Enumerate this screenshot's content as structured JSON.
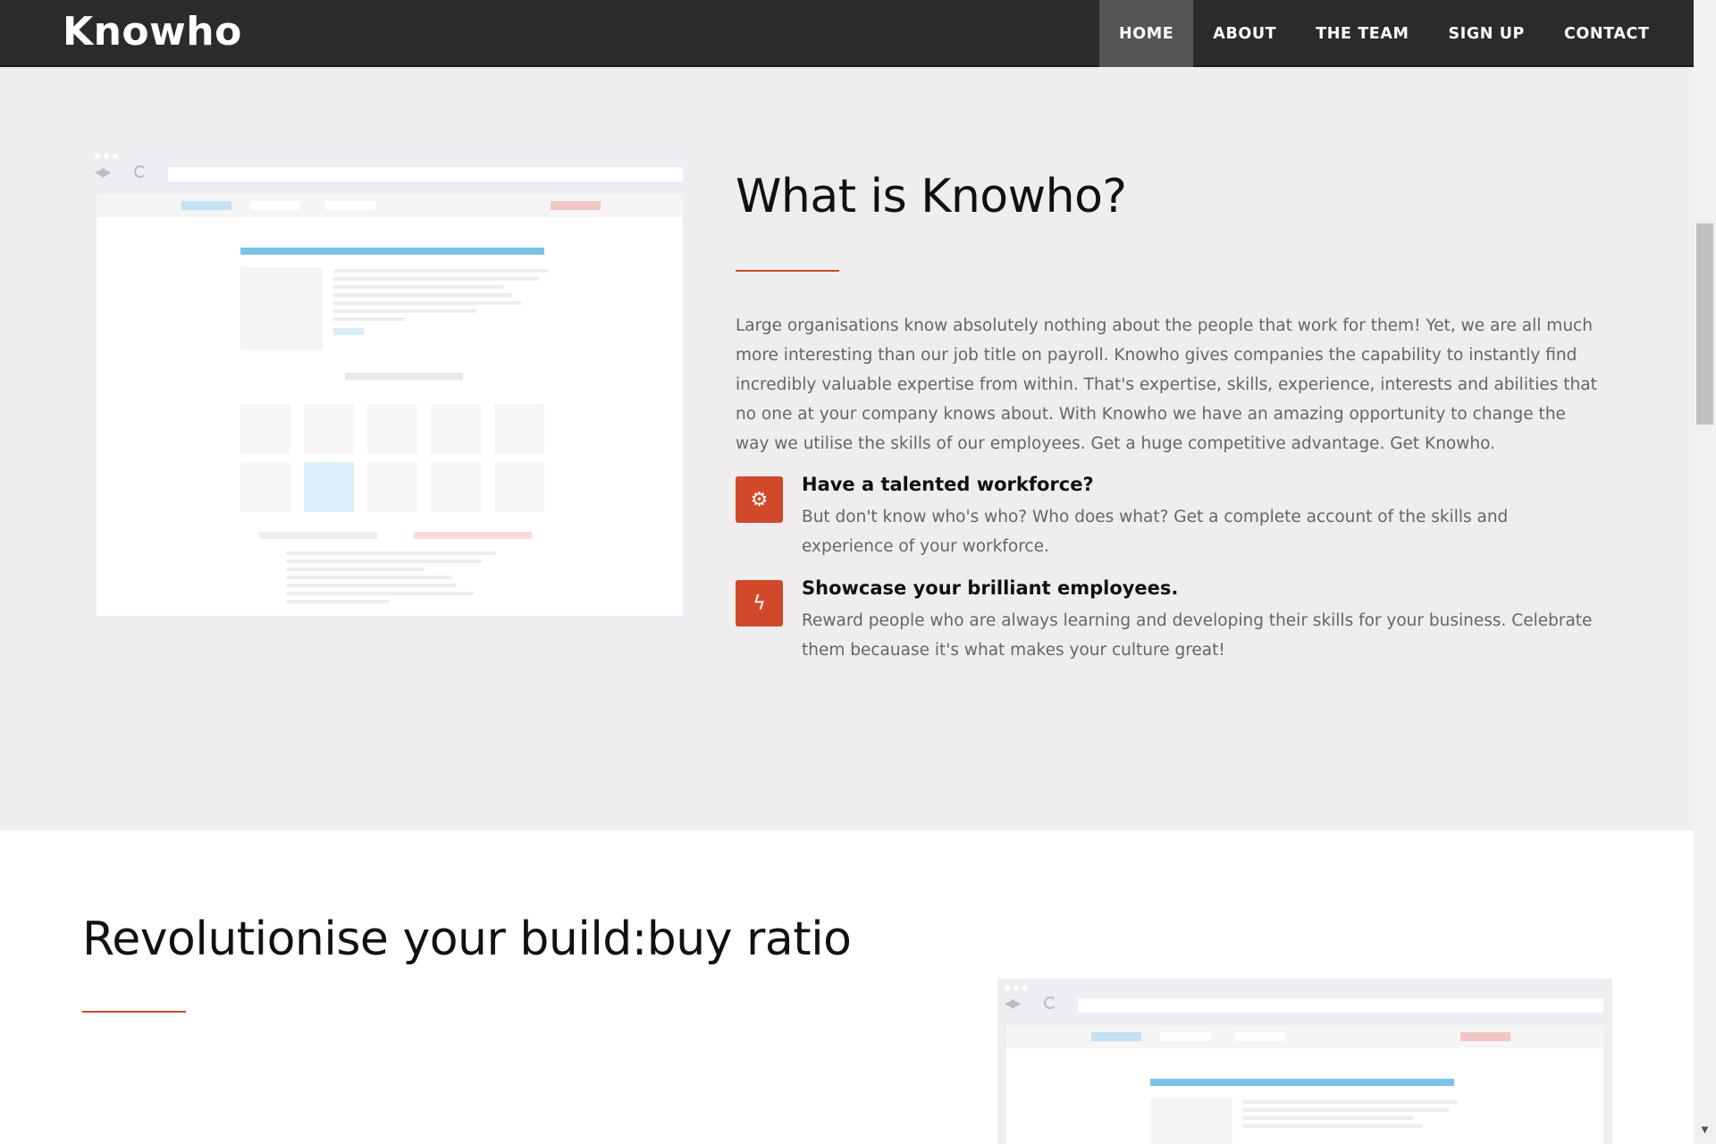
{
  "brand": "Knowho",
  "nav": [
    {
      "label": "HOME",
      "active": true
    },
    {
      "label": "ABOUT",
      "active": false
    },
    {
      "label": "THE TEAM",
      "active": false
    },
    {
      "label": "SIGN UP",
      "active": false
    },
    {
      "label": "CONTACT",
      "active": false
    }
  ],
  "about": {
    "title": "What is Knowho?",
    "body": "Large organisations know absolutely nothing about the people that work for them! Yet, we are all much more interesting than our job title on payroll. Knowho gives companies the capability to instantly find incredibly valuable expertise from within. That's expertise, skills, experience, interests and abilities that no one at your company knows about. With Knowho we have an amazing opportunity to change the way we utilise the skills of our employees. Get a huge competitive advantage. Get Knowho.",
    "features": [
      {
        "icon": "gear-icon",
        "title": "Have a talented workforce?",
        "text": "But don't know who's who? Who does what? Get a complete account of the skills and experience of your workforce."
      },
      {
        "icon": "lightning-icon",
        "title": "Showcase your brilliant employees.",
        "text": "Reward people who are always learning and developing their skills for your business. Celebrate them becauase it's what makes your culture great!"
      }
    ]
  },
  "ratio": {
    "title": "Revolutionise your build:buy ratio"
  },
  "colors": {
    "accent": "#d2492a",
    "navbar": "#2b2b2b",
    "nav_active": "#555555",
    "section_bg": "#efedee",
    "mock_blue": "#7ac3ea",
    "mock_red": "#f3c6c6"
  }
}
